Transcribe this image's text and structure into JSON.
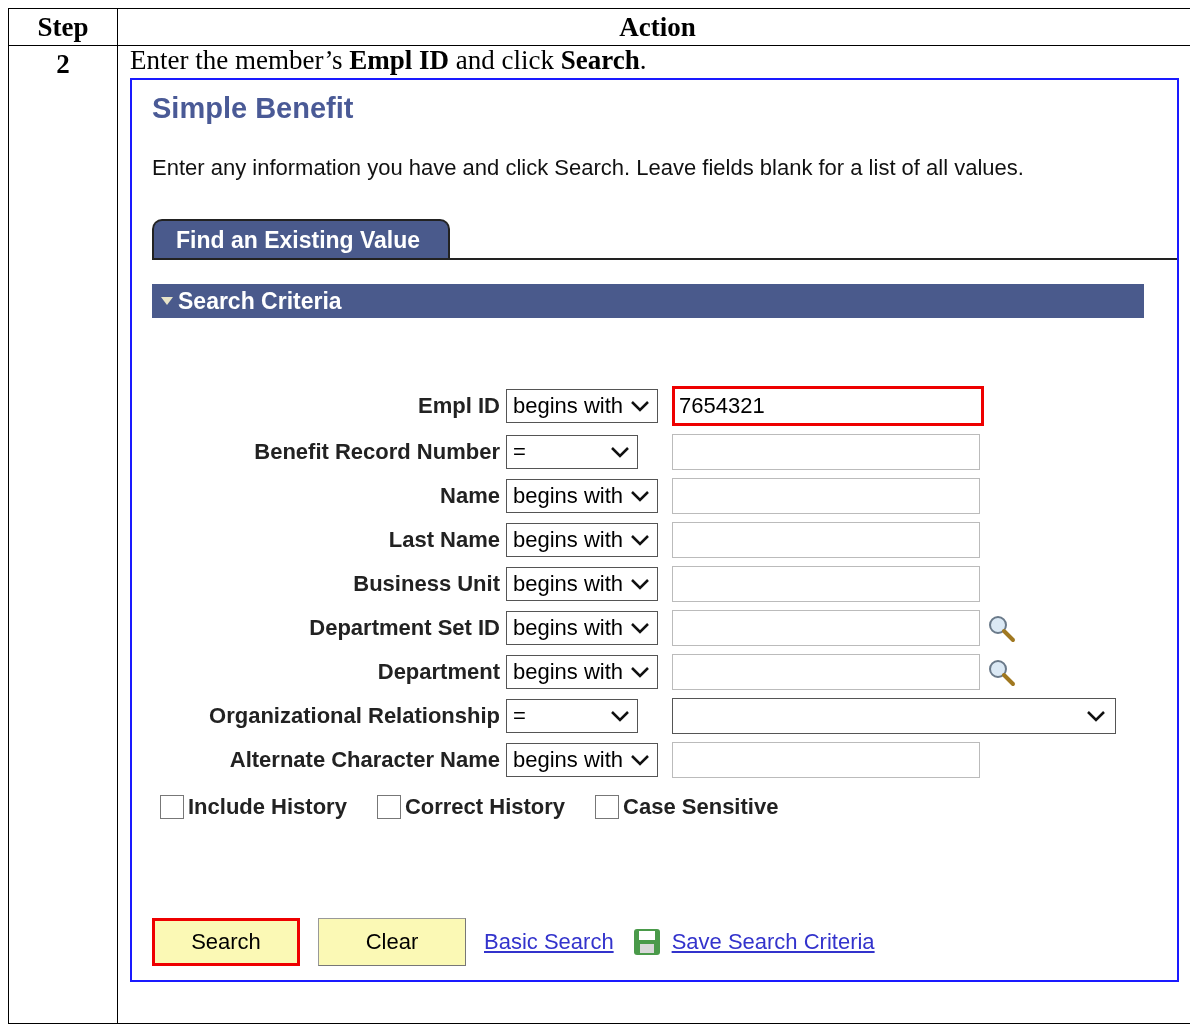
{
  "table": {
    "columns": [
      "Step",
      "Action"
    ],
    "rows": [
      {
        "step": "2",
        "instruction": "Enter the member’s **Empl ID** and click **Search**.",
        "screenshot": {
          "title": "Simple Benefit",
          "intro": "Enter any information you have and click Search. Leave fields blank for a list of all values.",
          "tabs": [
            {
              "label": "Find an Existing Value",
              "selected": true
            }
          ],
          "section": {
            "title": "Search Criteria",
            "expanded": true
          },
          "criteria": [
            {
              "label": "Empl ID",
              "operator": "begins with",
              "kind": "text",
              "value": "7654321",
              "lookup": false,
              "highlighted": true
            },
            {
              "label": "Benefit Record Number",
              "operator": "=",
              "kind": "text",
              "lookup": false,
              "highlighted": false
            },
            {
              "label": "Name",
              "operator": "begins with",
              "kind": "text",
              "lookup": false,
              "highlighted": false
            },
            {
              "label": "Last Name",
              "operator": "begins with",
              "kind": "text",
              "lookup": false,
              "highlighted": false
            },
            {
              "label": "Business Unit",
              "operator": "begins with",
              "kind": "text",
              "lookup": false,
              "highlighted": false
            },
            {
              "label": "Department Set ID",
              "operator": "begins with",
              "kind": "text",
              "lookup": true,
              "highlighted": false
            },
            {
              "label": "Department",
              "operator": "begins with",
              "kind": "text",
              "lookup": true,
              "highlighted": false
            },
            {
              "label": "Organizational Relationship",
              "operator": "=",
              "kind": "dropdown",
              "highlighted": false
            },
            {
              "label": "Alternate Character Name",
              "operator": "begins with",
              "kind": "text",
              "lookup": false,
              "highlighted": false
            }
          ],
          "checkboxes": [
            {
              "label": "Include History",
              "checked": false
            },
            {
              "label": "Correct History",
              "checked": false
            },
            {
              "label": "Case Sensitive",
              "checked": false
            }
          ],
          "buttons": [
            {
              "label": "Search",
              "highlighted": true
            },
            {
              "label": "Clear",
              "highlighted": false
            }
          ],
          "links": [
            {
              "label": "Basic Search",
              "kind": "plain"
            },
            {
              "label": "Save Search Criteria",
              "kind": "save"
            }
          ]
        }
      }
    ]
  }
}
